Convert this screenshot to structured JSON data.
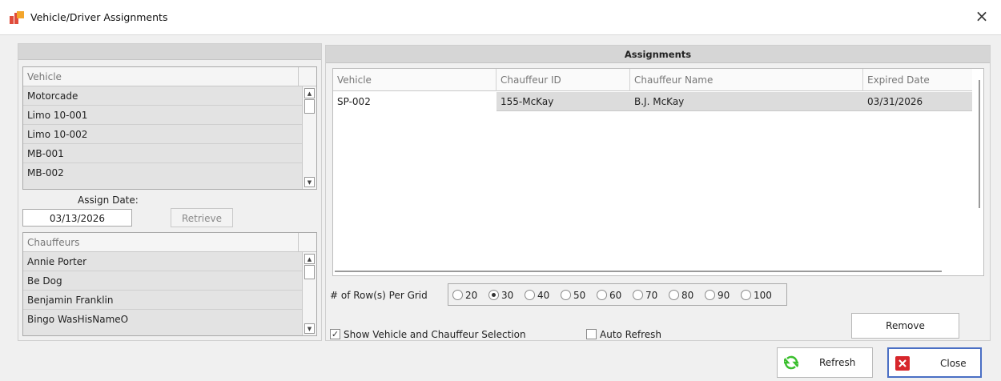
{
  "window": {
    "title": "Vehicle/Driver Assignments",
    "close_glyph": "×"
  },
  "vehicles": {
    "header": "Vehicle",
    "items": [
      "Motorcade",
      "Limo 10-001",
      "Limo 10-002",
      "MB-001",
      "MB-002"
    ]
  },
  "assign": {
    "label": "Assign Date:",
    "date": "03/13/2026",
    "retrieve_label": "Retrieve"
  },
  "chauffeurs": {
    "header": "Chauffeurs",
    "items": [
      "Annie Porter",
      "Be Dog",
      "Benjamin Franklin",
      "Bingo WasHisNameO"
    ]
  },
  "assignments": {
    "title": "Assignments",
    "columns": [
      "Vehicle",
      "Chauffeur ID",
      "Chauffeur Name",
      "Expired Date"
    ],
    "rows": [
      {
        "vehicle": "SP-002",
        "chauffeur_id": "155-McKay",
        "chauffeur_name": "B.J. McKay",
        "expired_date": "03/31/2026"
      }
    ]
  },
  "rows_per_grid": {
    "label": "# of Row(s) Per Grid",
    "options": [
      "20",
      "30",
      "40",
      "50",
      "60",
      "70",
      "80",
      "90",
      "100"
    ],
    "selected": "30"
  },
  "options": {
    "show_selection": {
      "label": "Show Vehicle and Chauffeur Selection",
      "checked": true
    },
    "auto_refresh": {
      "label": "Auto Refresh",
      "checked": false
    }
  },
  "buttons": {
    "remove": "Remove",
    "refresh": "Refresh",
    "close": "Close"
  },
  "colors": {
    "refresh_icon": "#3bbf2e",
    "close_icon": "#d7262b",
    "focus_border": "#4a6fc4",
    "app_icon_red": "#e04b3a",
    "app_icon_orange": "#f3a52b"
  },
  "icons": {
    "app": "app-logo-icon",
    "scroll_up": "arrow-up-icon",
    "scroll_down": "arrow-down-icon",
    "refresh": "refresh-icon",
    "close": "close-icon",
    "check": "checkmark-icon"
  }
}
